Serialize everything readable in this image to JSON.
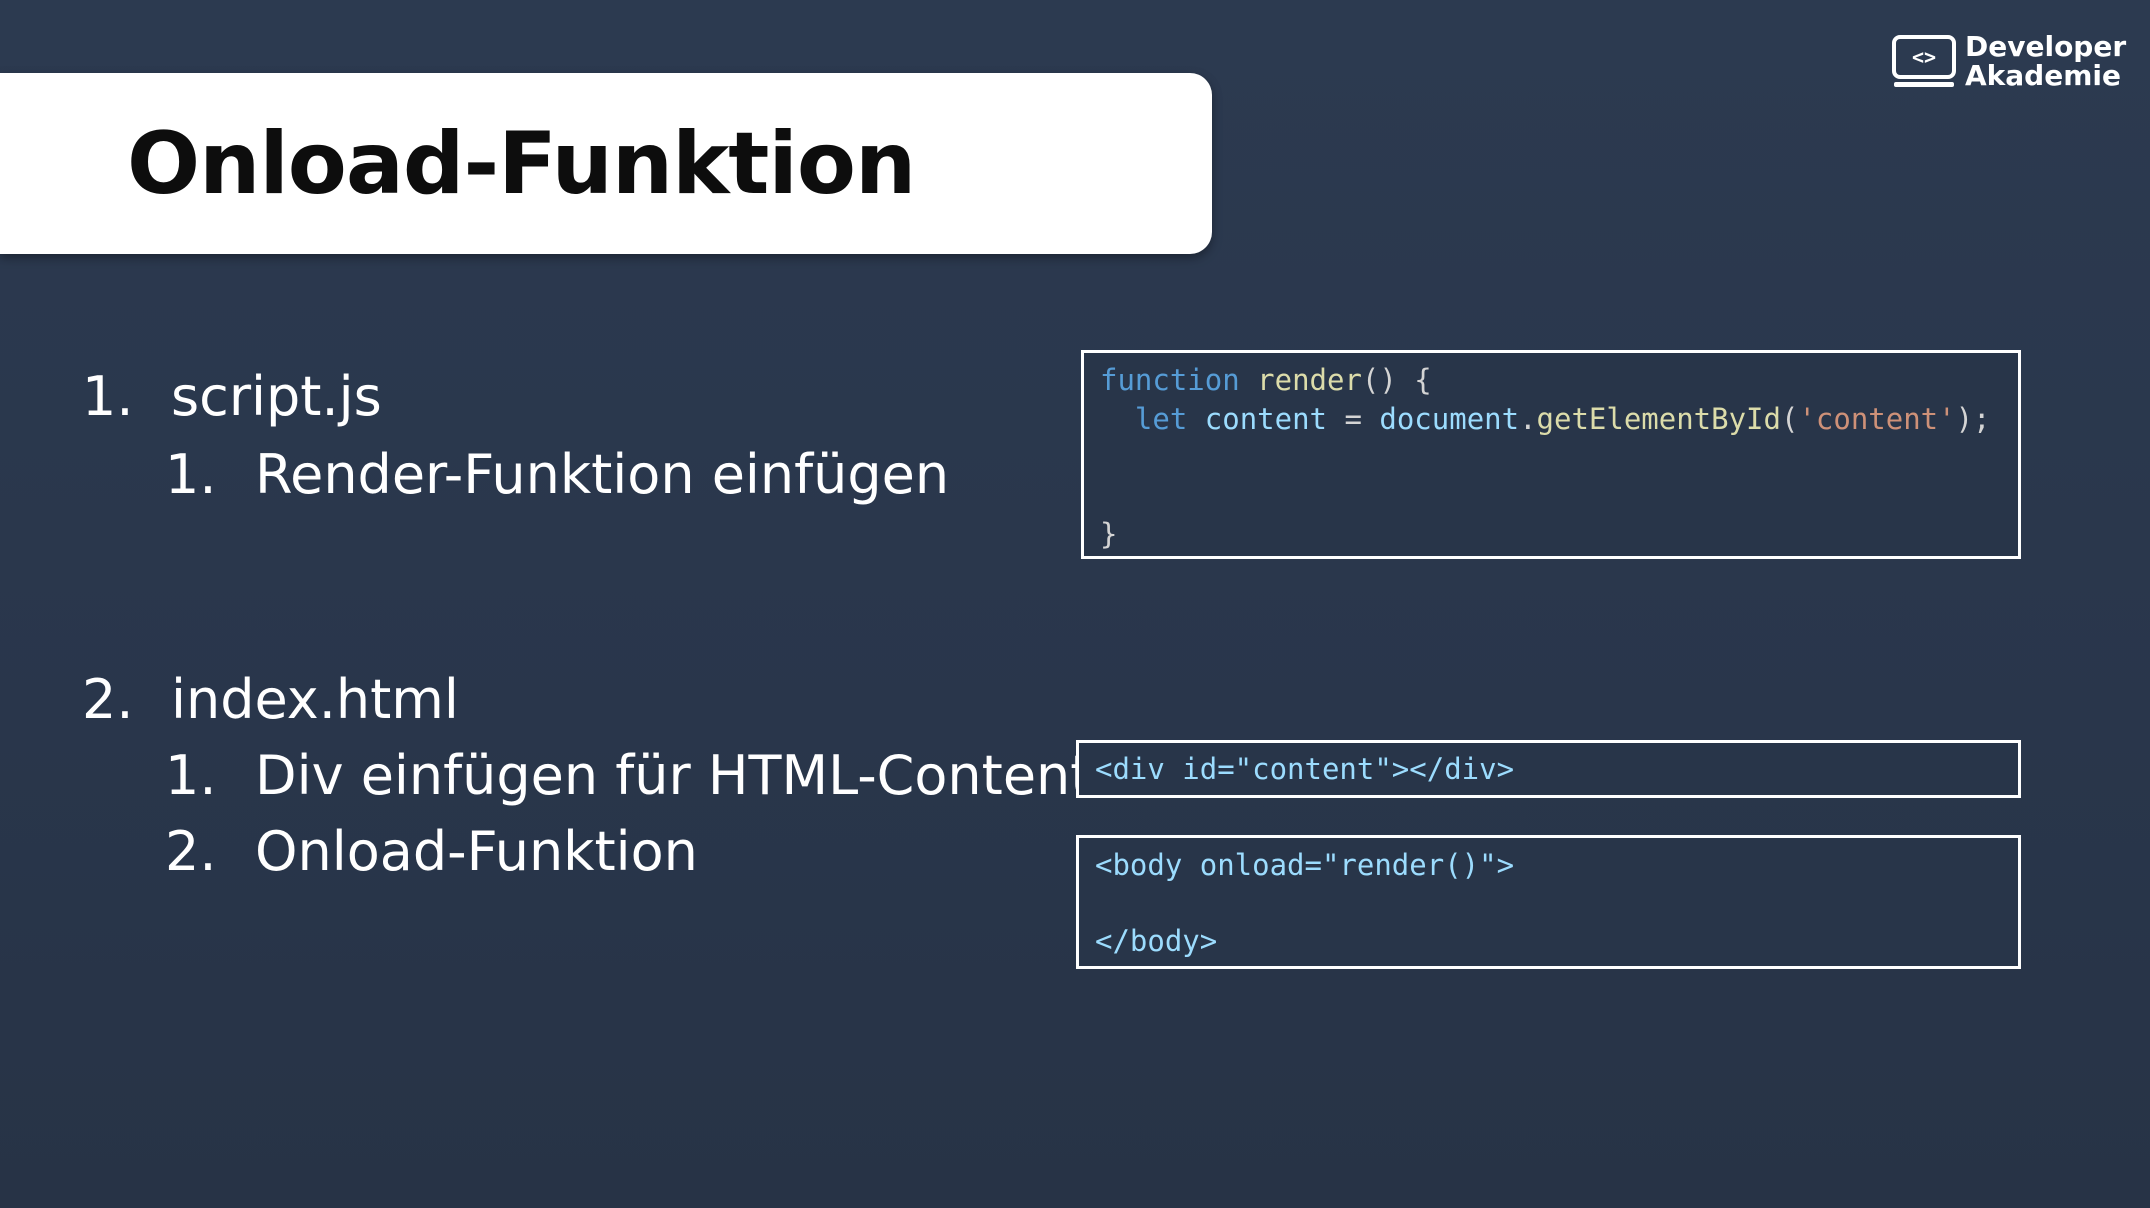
{
  "title": "Onload-Funktion",
  "logo": {
    "icon_glyph": "<>",
    "line1": "Developer",
    "line2": "Akademie"
  },
  "list": [
    {
      "number": "1.",
      "label": "script.js",
      "children": [
        {
          "number": "1.",
          "label": "Render-Funktion einfügen"
        }
      ]
    },
    {
      "number": "2.",
      "label": "index.html",
      "children": [
        {
          "number": "1.",
          "label": "Div einfügen für HTML-Content"
        },
        {
          "number": "2.",
          "label": "Onload-Funktion"
        }
      ]
    }
  ],
  "code": {
    "render_function": {
      "line1": {
        "kw": "function",
        "fn": "render",
        "rest": "() {"
      },
      "line2": {
        "indent": "  ",
        "kw": "let",
        "var": "content",
        "eq": " = ",
        "obj": "document",
        "dot": ".",
        "method": "getElementById",
        "open": "(",
        "str": "'content'",
        "close": ");"
      },
      "line3": "}"
    },
    "div_snippet": "<div id=\"content\"></div>",
    "body_snippet": {
      "open": "<body onload=\"render()\">",
      "close": "</body>"
    }
  },
  "colors": {
    "background": "#2a374c",
    "title_card": "#ffffff",
    "code_keyword": "#569cd6",
    "code_function": "#dcdcaa",
    "code_variable": "#9cdcfe",
    "code_string": "#ce9178"
  }
}
